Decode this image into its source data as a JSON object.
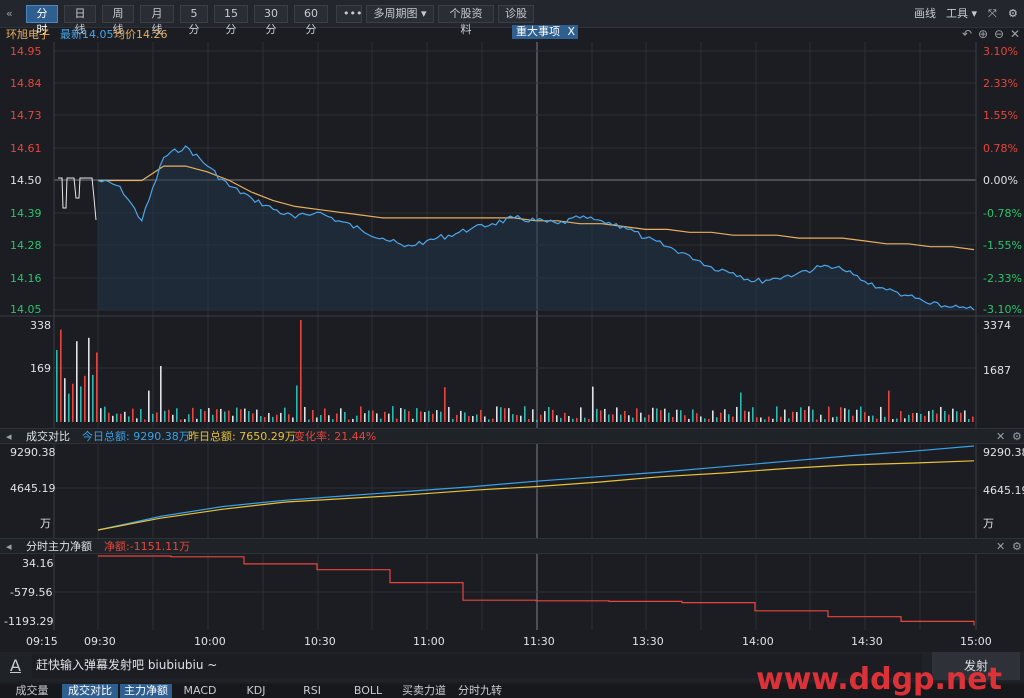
{
  "toolbar": {
    "back_icon": "double-chevron-left-icon",
    "tabs": [
      "分时",
      "日线",
      "周线",
      "月线",
      "5分",
      "15分",
      "30分",
      "60分"
    ],
    "more": "•••",
    "multi_cycle": "多周期图",
    "stock_info": "个股资料",
    "diagnose": "诊股",
    "draw_line": "画线",
    "tools": "工具"
  },
  "header": {
    "stock_name": "环旭电子",
    "latest": "最新14.05",
    "avg": "均价14.26",
    "major_event": "重大事项",
    "close_x": "X"
  },
  "price_axis": {
    "left": [
      "14.95",
      "14.84",
      "14.73",
      "14.61",
      "14.50",
      "14.39",
      "14.28",
      "14.16",
      "14.05"
    ],
    "right": [
      "3.10%",
      "2.33%",
      "1.55%",
      "0.78%",
      "0.00%",
      "-0.78%",
      "-1.55%",
      "-2.33%",
      "-3.10%"
    ]
  },
  "volume_axis": {
    "left": [
      "338",
      "169"
    ],
    "right": [
      "3374",
      "1687"
    ]
  },
  "turnover_panel": {
    "title": "成交对比",
    "today": "今日总额: 9290.38万",
    "yesterday": "昨日总额: 7650.29万",
    "change": "变化率: 21.44%",
    "left": [
      "9290.38",
      "4645.19",
      "万"
    ],
    "right": [
      "9290.38",
      "4645.19",
      "万"
    ]
  },
  "flow_panel": {
    "title": "分时主力净额",
    "net": "净额:-1151.11万",
    "left": [
      "34.16",
      "-579.56",
      "-1193.29"
    ]
  },
  "time_axis": [
    "09:15",
    "09:30",
    "10:00",
    "10:30",
    "11:00",
    "11:30",
    "13:30",
    "14:00",
    "14:30",
    "15:00"
  ],
  "danmaku": {
    "placeholder": "赶快输入弹幕发射吧 biubiubiu ~",
    "send": "发射",
    "icon": "font-a-icon"
  },
  "bottom_tabs": [
    "成交量",
    "成交对比",
    "主力净额",
    "MACD",
    "KDJ",
    "RSI",
    "BOLL",
    "买卖力道",
    "分时九转"
  ],
  "watermark": "www.ddgp.net",
  "colors": {
    "accent": "#2f5f8f",
    "price_line": "#4aa6ea",
    "avg_line": "#e8b060",
    "red": "#e8463c",
    "green": "#2dc36a",
    "yellow": "#e8c23a"
  },
  "chart_data": [
    {
      "type": "line",
      "title": "环旭电子",
      "series": [
        {
          "name": "最新",
          "values": [
            14.5,
            14.48,
            14.36,
            14.58,
            14.62,
            14.55,
            14.48,
            14.44,
            14.4,
            14.37,
            14.39,
            14.36,
            14.33,
            14.3,
            14.27,
            14.29,
            14.31,
            14.33,
            14.35,
            14.37,
            14.36,
            14.35,
            14.37,
            14.36,
            14.34,
            14.3,
            14.27,
            14.24,
            14.2,
            14.18,
            14.15,
            14.16,
            14.18,
            14.2,
            14.19,
            14.15,
            14.12,
            14.1,
            14.07,
            14.06,
            14.05
          ]
        },
        {
          "name": "均价",
          "values": [
            14.5,
            14.5,
            14.5,
            14.55,
            14.55,
            14.53,
            14.5,
            14.46,
            14.43,
            14.41,
            14.4,
            14.39,
            14.38,
            14.37,
            14.37,
            14.37,
            14.37,
            14.37,
            14.37,
            14.37,
            14.36,
            14.36,
            14.35,
            14.35,
            14.34,
            14.33,
            14.33,
            14.32,
            14.32,
            14.31,
            14.31,
            14.31,
            14.3,
            14.3,
            14.3,
            14.29,
            14.28,
            14.28,
            14.27,
            14.27,
            14.26
          ]
        }
      ],
      "ylim": [
        14.05,
        14.95
      ]
    },
    {
      "type": "line",
      "title": "成交对比",
      "series": [
        {
          "name": "今日总额",
          "values": [
            0,
            1500,
            2600,
            3300,
            3800,
            4300,
            4800,
            5400,
            5900,
            6400,
            7000,
            7600,
            8200,
            8700,
            9290.38
          ]
        },
        {
          "name": "昨日总额",
          "values": [
            0,
            1300,
            2300,
            3100,
            3500,
            3900,
            4400,
            4800,
            5300,
            5900,
            6300,
            6800,
            7200,
            7400,
            7650.29
          ]
        }
      ],
      "ylim": [
        0,
        9290.38
      ]
    },
    {
      "type": "line",
      "title": "分时主力净额",
      "series": [
        {
          "name": "净额",
          "values": [
            34.16,
            20,
            -100,
            -200,
            -420,
            -720,
            -730,
            -740,
            -760,
            -900,
            -1000,
            -1080,
            -1151.11
          ]
        }
      ],
      "ylim": [
        -1193.29,
        34.16
      ]
    }
  ]
}
